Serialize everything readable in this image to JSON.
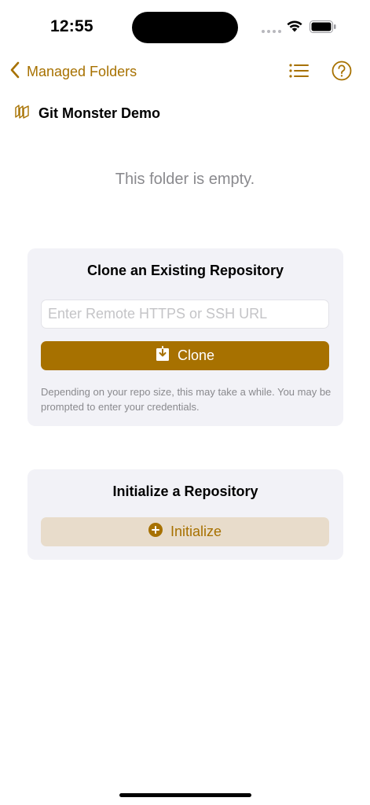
{
  "status_bar": {
    "time": "12:55"
  },
  "nav": {
    "back_label": "Managed Folders",
    "accent_color": "#a77100"
  },
  "folder": {
    "name": "Git Monster Demo"
  },
  "empty_message": "This folder is empty.",
  "clone_card": {
    "title": "Clone an Existing Repository",
    "url_placeholder": "Enter Remote HTTPS or SSH URL",
    "url_value": "",
    "button_label": "Clone",
    "note": "Depending on your repo size, this may take a while. You may be prompted to enter your credentials."
  },
  "init_card": {
    "title": "Initialize a Repository",
    "button_label": "Initialize"
  },
  "icons": {
    "back": "chevron-left-icon",
    "list": "list-icon",
    "help": "question-mark-circle-icon",
    "folder": "repository-icon",
    "clone": "download-tray-icon",
    "initialize": "plus-circle-icon"
  }
}
